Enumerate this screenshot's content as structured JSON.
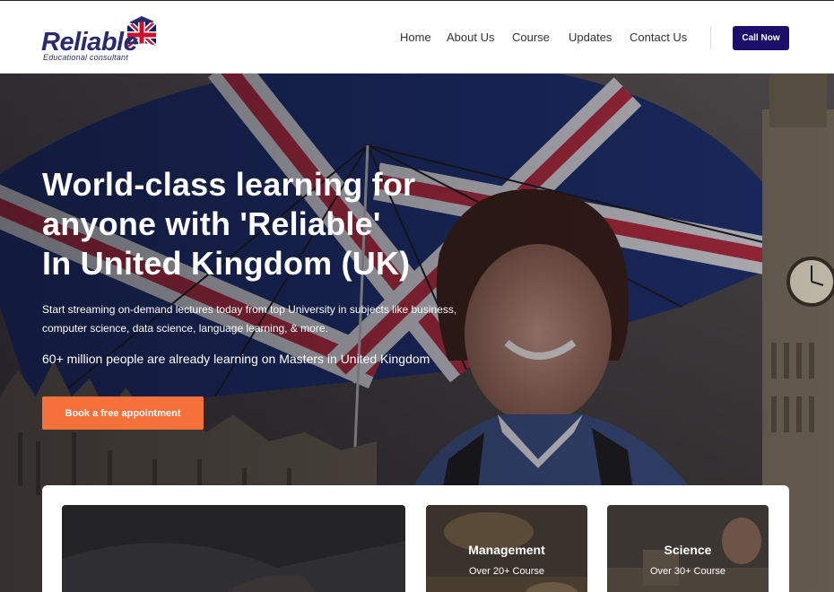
{
  "brand": {
    "name": "Reliable",
    "tagline": "Educational consultant"
  },
  "nav": {
    "items": [
      {
        "label": "Home"
      },
      {
        "label": "About Us"
      },
      {
        "label": "Course"
      },
      {
        "label": "Updates"
      },
      {
        "label": "Contact Us"
      }
    ],
    "cta_label": "Call Now"
  },
  "hero": {
    "title_lines": [
      "World-class learning for",
      "anyone with 'Reliable'",
      "In United Kingdom (UK)"
    ],
    "description": "Start streaming on-demand lectures today from top University in subjects like business, computer science, data science, language learning, & more.",
    "stat": "60+ million people are already learning on Masters in United Kingdom",
    "button_label": "Book a free appointment"
  },
  "cards": [
    {
      "title": "",
      "subtitle": ""
    },
    {
      "title": "Management",
      "subtitle": "Over 20+ Course"
    },
    {
      "title": "Science",
      "subtitle": "Over 30+ Course"
    }
  ],
  "colors": {
    "brand_navy": "#2a2b6e",
    "cta_bg": "#1b0f6b",
    "book_btn": "#f5703a",
    "flag_red": "#c8102e",
    "flag_blue": "#012169"
  },
  "icons": {
    "logo_flag": "union-jack-icon"
  }
}
